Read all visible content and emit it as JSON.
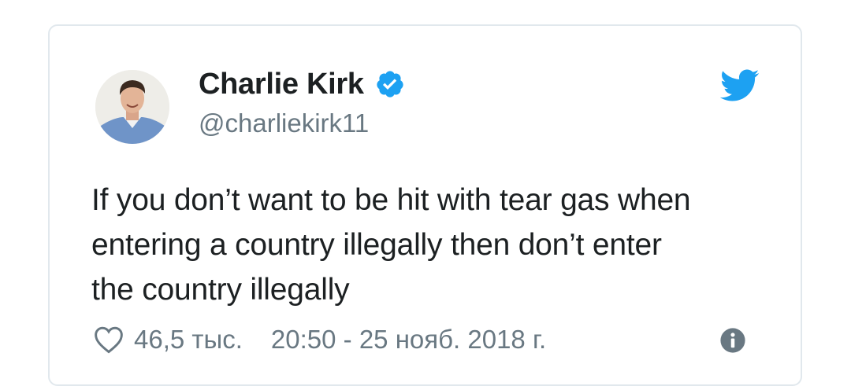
{
  "tweet": {
    "author_name": "Charlie Kirk",
    "author_handle": "@charliekirk11",
    "text_lines": [
      "If you don’t want to be hit with tear gas when",
      "entering a country illegally then don’t enter",
      "the country illegally"
    ],
    "likes": "46,5 тыс.",
    "timestamp": "20:50 - 25 нояб. 2018 г."
  },
  "icons": {
    "verified": "verified-badge-icon",
    "brand": "twitter-bird-icon",
    "like": "heart-icon",
    "info": "info-icon"
  },
  "colors": {
    "brand_blue": "#1da1f2",
    "text_primary": "#1c2022",
    "text_secondary": "#697882",
    "border": "#e1e8ed"
  }
}
